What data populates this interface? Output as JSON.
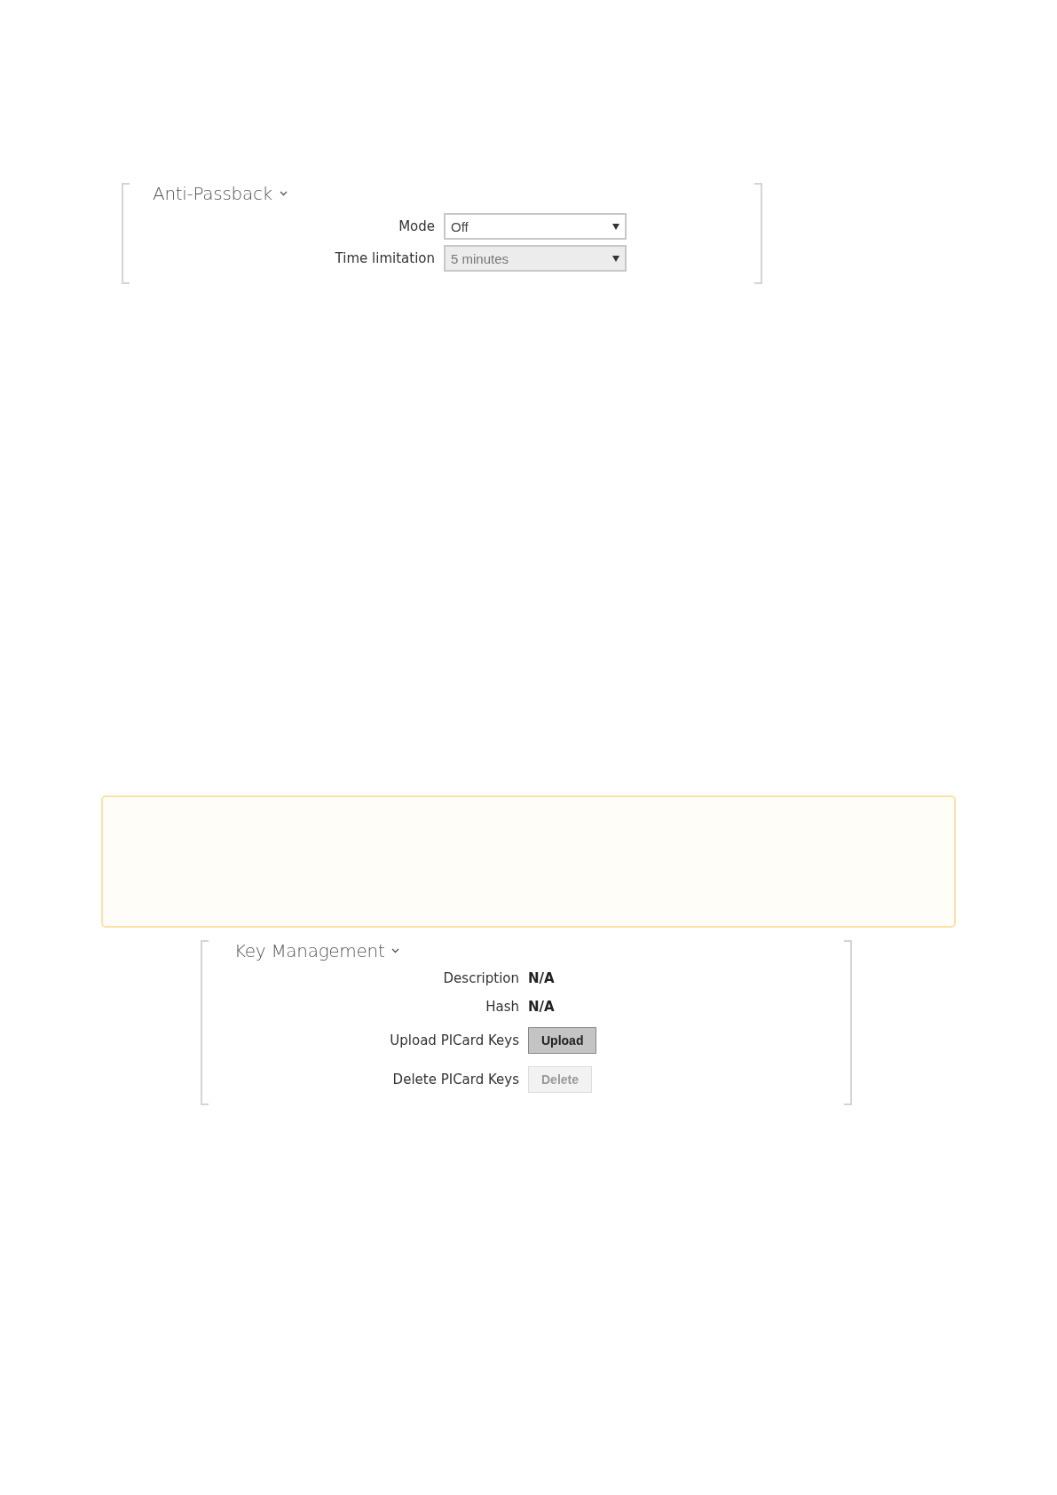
{
  "anti_passback": {
    "title": "Anti-Passback",
    "rows": [
      {
        "kind": "select",
        "label": "Mode",
        "value": "Off",
        "disabled": false
      },
      {
        "kind": "select",
        "label": "Time limitation",
        "value": "5 minutes",
        "disabled": true
      }
    ]
  },
  "key_management": {
    "title": "Key Management",
    "rows": [
      {
        "kind": "value",
        "label": "Description",
        "value": "N/A"
      },
      {
        "kind": "value",
        "label": "Hash",
        "value": "N/A"
      },
      {
        "kind": "button",
        "label": "Upload PICard Keys",
        "button": "Upload",
        "disabled": false
      },
      {
        "kind": "button",
        "label": "Delete PICard Keys",
        "button": "Delete",
        "disabled": true
      }
    ]
  }
}
